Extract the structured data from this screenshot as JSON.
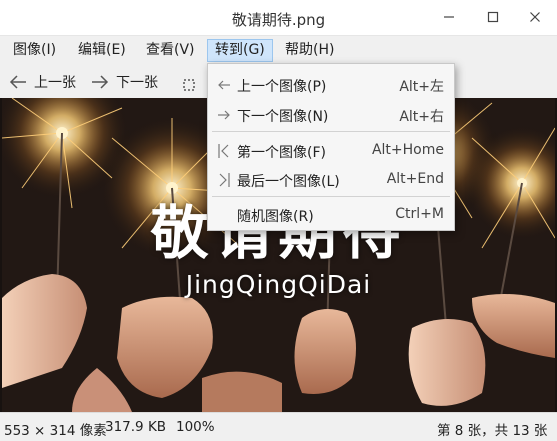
{
  "window": {
    "title": "敬请期待.png"
  },
  "menubar": {
    "items": [
      {
        "label": "图像(I)"
      },
      {
        "label": "编辑(E)"
      },
      {
        "label": "查看(V)"
      },
      {
        "label": "转到(G)"
      },
      {
        "label": "帮助(H)"
      }
    ]
  },
  "toolbar": {
    "prev_label": "上一张",
    "next_label": "下一张"
  },
  "goto_menu": {
    "items": [
      {
        "label": "上一个图像(P)",
        "shortcut": "Alt+左",
        "icon": "arrow-left-icon"
      },
      {
        "label": "下一个图像(N)",
        "shortcut": "Alt+右",
        "icon": "arrow-right-icon"
      },
      {
        "label": "第一个图像(F)",
        "shortcut": "Alt+Home",
        "icon": "first-image-icon"
      },
      {
        "label": "最后一个图像(L)",
        "shortcut": "Alt+End",
        "icon": "last-image-icon"
      },
      {
        "label": "随机图像(R)",
        "shortcut": "Ctrl+M",
        "icon": ""
      }
    ]
  },
  "image": {
    "title_text": "敬请期待",
    "subtitle_text": "JingQingQiDai"
  },
  "statusbar": {
    "dimensions": "553 × 314 像素",
    "filesize": "317.9 KB",
    "zoom": "100%",
    "position": "第 8 张，共 13 张"
  },
  "colors": {
    "menu_highlight": "#cfe5fb",
    "menu_highlight_border": "#9cc6ee",
    "background": "#f0f0f0"
  }
}
